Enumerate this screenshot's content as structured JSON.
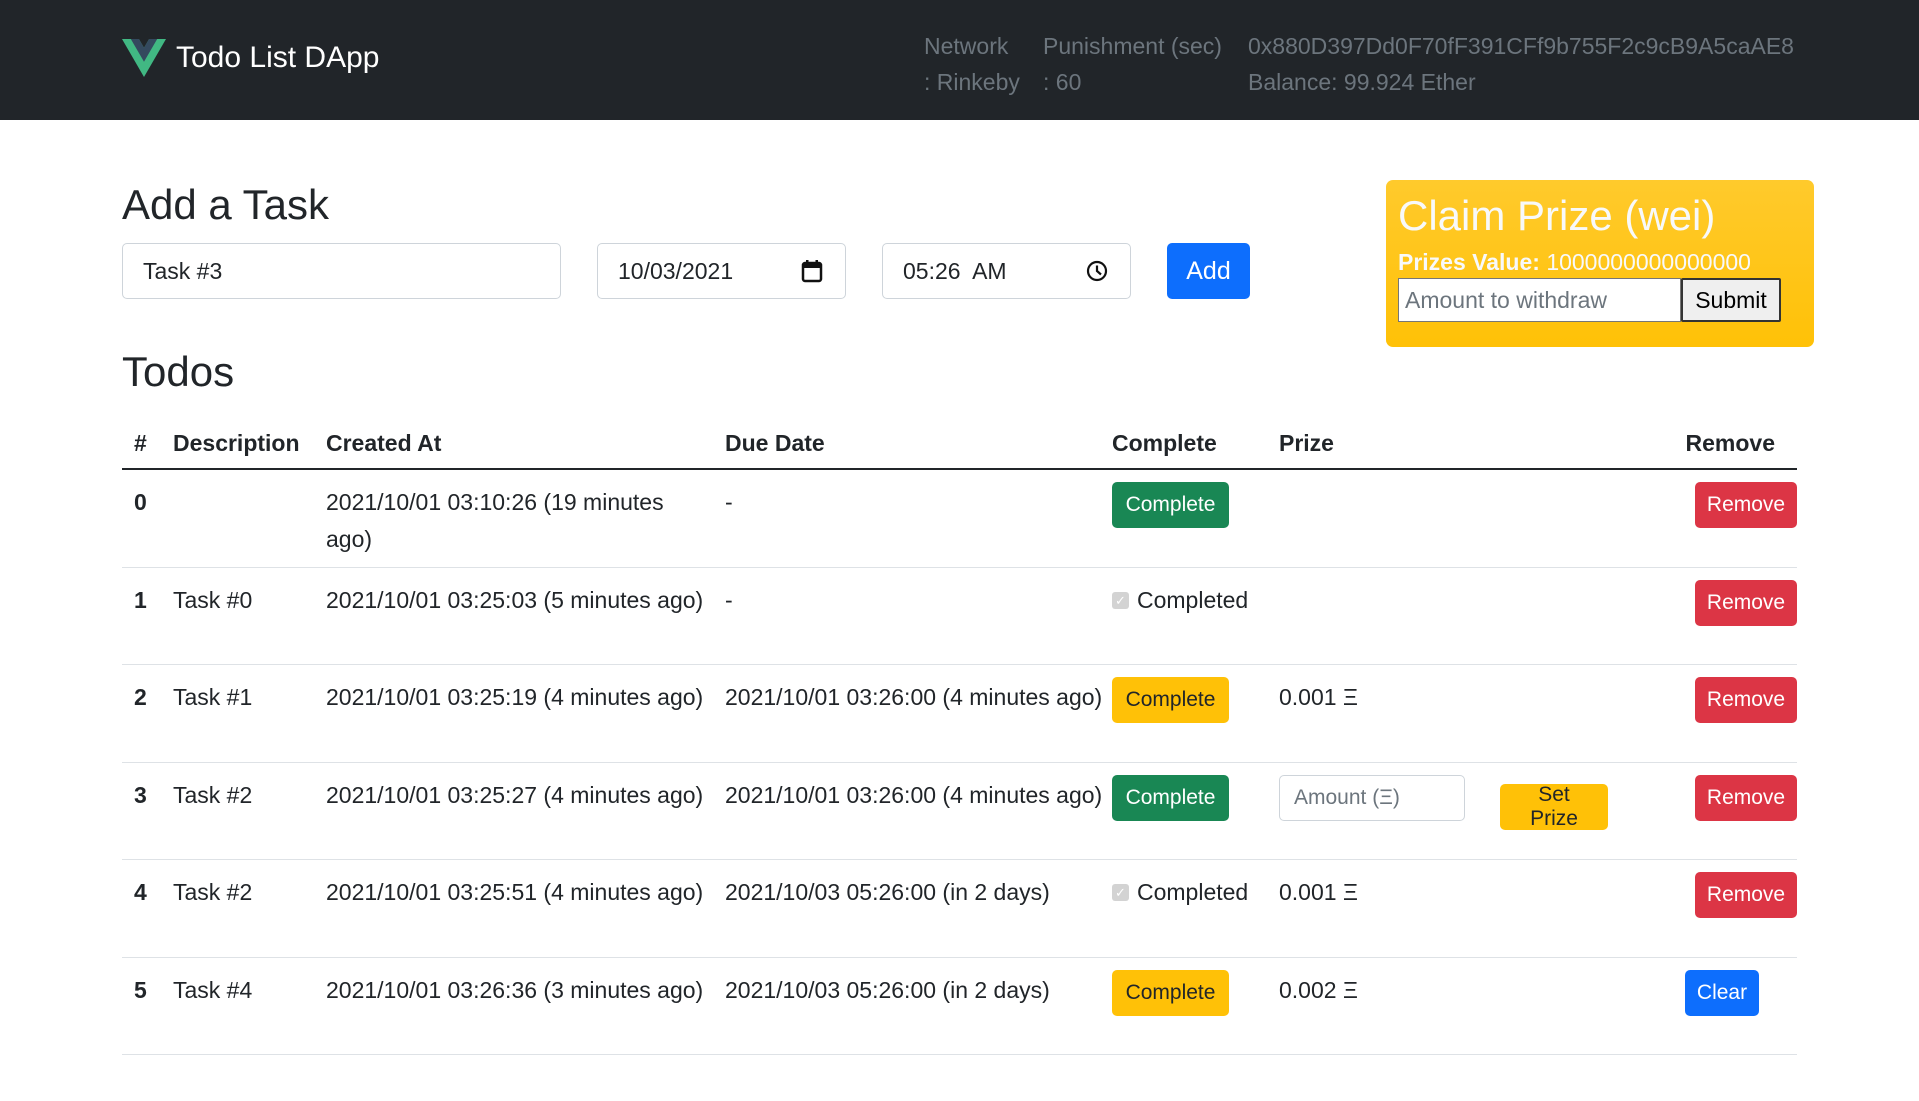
{
  "navbar": {
    "title": "Todo List DApp",
    "network_label": "Network",
    "network_value": ": Rinkeby",
    "punishment_label": "Punishment (sec)",
    "punishment_value": ": 60",
    "account_address": "0x880D397Dd0F70fF391CFf9b755F2c9cB9A5caAE8",
    "balance": "Balance: 99.924 Ether",
    "logo_icon": "vue-logo-icon"
  },
  "add_task": {
    "title": "Add a Task",
    "description_value": "Task #3",
    "date_value": "10/03/2021",
    "time_value": "05:26  AM",
    "date_icon": "calendar-icon",
    "time_icon": "clock-icon",
    "add_label": "Add"
  },
  "claim_prize": {
    "title": "Claim Prize (wei)",
    "prizes_value_label": "Prizes Value",
    "prizes_value": "1000000000000000",
    "amount_placeholder": "Amount to withdraw",
    "submit_label": "Submit"
  },
  "todos": {
    "title": "Todos",
    "columns": [
      "#",
      "Description",
      "Created At",
      "Due Date",
      "Complete",
      "Prize",
      "Remove"
    ],
    "rows": [
      {
        "id": "0",
        "description": "",
        "created_at": "2021/10/01 03:10:26 (19 minutes ago)",
        "due_date": "-",
        "complete": {
          "type": "button",
          "label": "Complete",
          "variant": "success"
        },
        "prize": "",
        "set_prize": null,
        "action": {
          "label": "Remove",
          "variant": "danger"
        }
      },
      {
        "id": "1",
        "description": "Task #0",
        "created_at": "2021/10/01 03:25:03 (5 minutes ago)",
        "due_date": "-",
        "complete": {
          "type": "checkbox",
          "label": "Completed"
        },
        "prize": "",
        "set_prize": null,
        "action": {
          "label": "Remove",
          "variant": "danger"
        }
      },
      {
        "id": "2",
        "description": "Task #1",
        "created_at": "2021/10/01 03:25:19 (4 minutes ago)",
        "due_date": "2021/10/01 03:26:00 (4 minutes ago)",
        "complete": {
          "type": "button",
          "label": "Complete",
          "variant": "warning"
        },
        "prize": "0.001 Ξ",
        "set_prize": null,
        "action": {
          "label": "Remove",
          "variant": "danger"
        }
      },
      {
        "id": "3",
        "description": "Task #2",
        "created_at": "2021/10/01 03:25:27 (4 minutes ago)",
        "due_date": "2021/10/01 03:26:00 (4 minutes ago)",
        "complete": {
          "type": "button",
          "label": "Complete",
          "variant": "success"
        },
        "prize": "",
        "set_prize": {
          "placeholder": "Amount (Ξ)",
          "label": "Set Prize"
        },
        "action": {
          "label": "Remove",
          "variant": "danger"
        }
      },
      {
        "id": "4",
        "description": "Task #2",
        "created_at": "2021/10/01 03:25:51 (4 minutes ago)",
        "due_date": "2021/10/03 05:26:00 (in 2 days)",
        "complete": {
          "type": "checkbox",
          "label": "Completed"
        },
        "prize": "0.001 Ξ",
        "set_prize": null,
        "action": {
          "label": "Remove",
          "variant": "danger"
        }
      },
      {
        "id": "5",
        "description": "Task #4",
        "created_at": "2021/10/01 03:26:36 (3 minutes ago)",
        "due_date": "2021/10/03 05:26:00 (in 2 days)",
        "complete": {
          "type": "button",
          "label": "Complete",
          "variant": "warning"
        },
        "prize": "0.002 Ξ",
        "set_prize": null,
        "action": {
          "label": "Clear",
          "variant": "primary"
        }
      }
    ]
  },
  "colors": {
    "navbar_bg": "#212529",
    "primary": "#0d6efd",
    "success": "#198754",
    "warning": "#ffc107",
    "danger": "#dc3545",
    "vue_green": "#41b883",
    "vue_dark": "#34495e"
  }
}
